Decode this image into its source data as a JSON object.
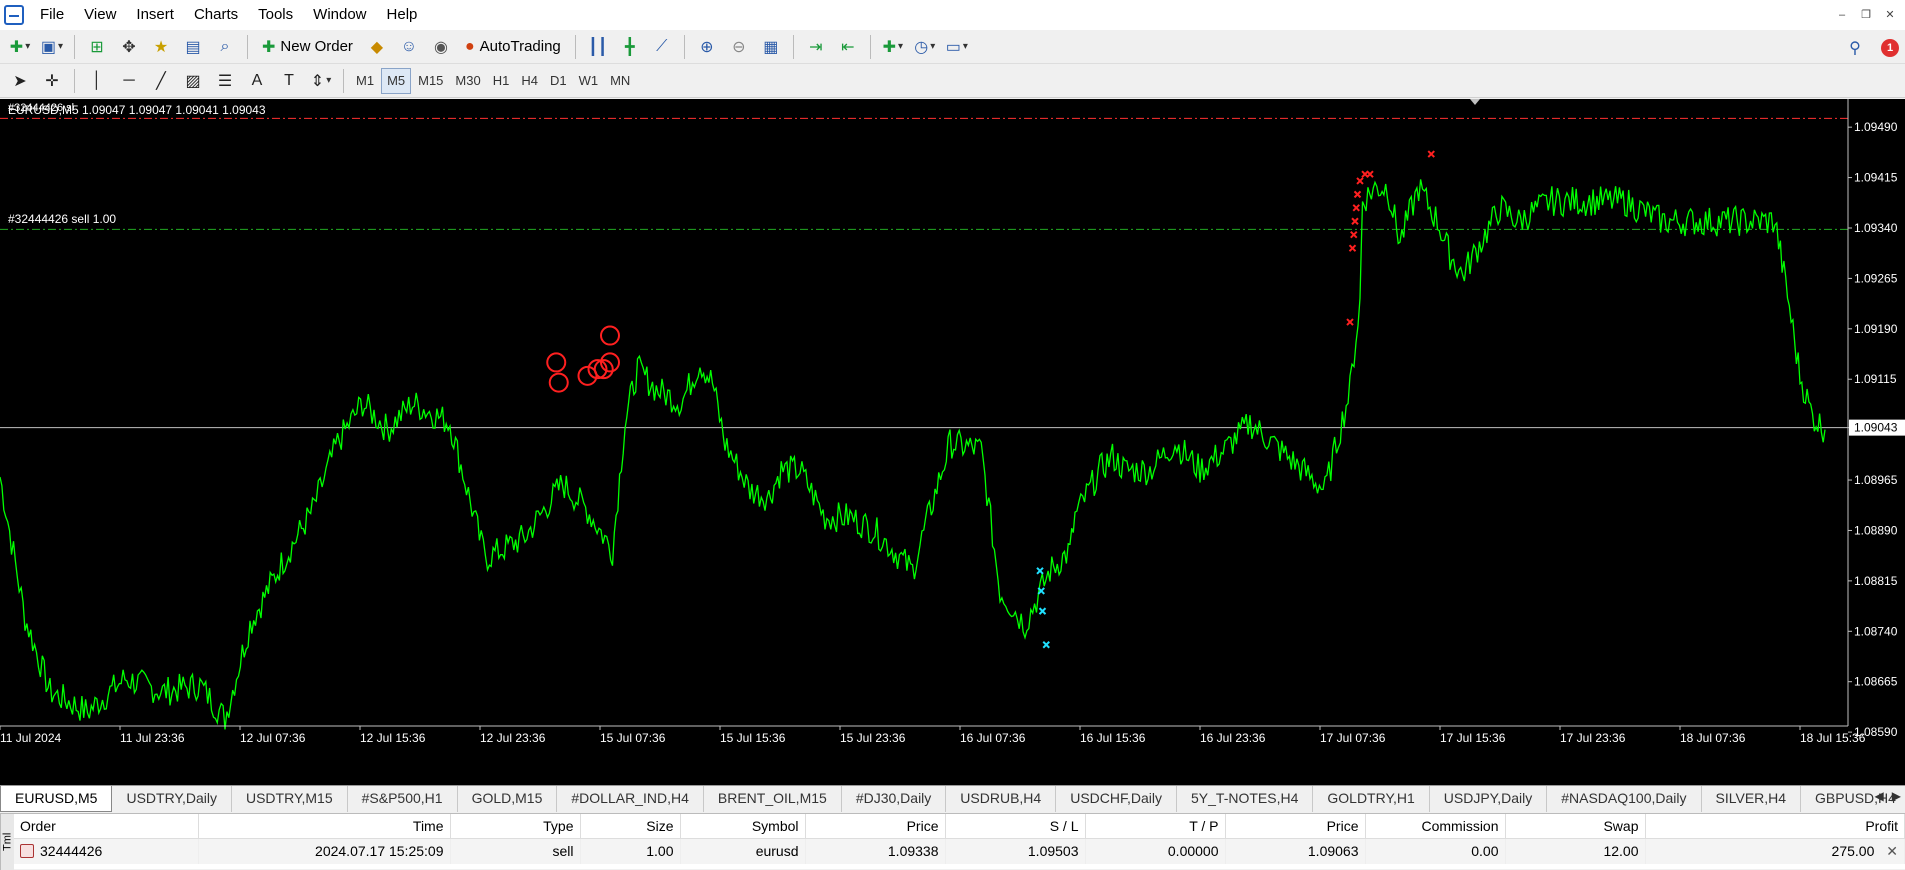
{
  "menu": [
    "File",
    "View",
    "Insert",
    "Charts",
    "Tools",
    "Window",
    "Help"
  ],
  "toolbar": {
    "new_order": "New Order",
    "autotrading": "AutoTrading",
    "alert_count": "1"
  },
  "timeframes": [
    "M1",
    "M5",
    "M15",
    "M30",
    "H1",
    "H4",
    "D1",
    "W1",
    "MN"
  ],
  "active_timeframe": "M5",
  "chart": {
    "symbol_line": "EURUSD,M5  1.09047 1.09047 1.09041 1.09043",
    "order_tag": "#32444426 sl",
    "sell_line_label": "#32444426 sell 1.00",
    "current_price_label": "1.09043",
    "colors": {
      "background": "#000000",
      "line": "#00ff00",
      "sl_line": "#ff3030",
      "order_line": "#22aa22",
      "current_price": "#c0c0c0"
    }
  },
  "chart_data": {
    "type": "line",
    "symbol": "EURUSD",
    "timeframe": "M5",
    "ylim": [
      1.0855,
      1.0952
    ],
    "y_ticks": [
      1.0949,
      1.09415,
      1.0934,
      1.09265,
      1.0919,
      1.09115,
      1.09043,
      1.08965,
      1.0889,
      1.08815,
      1.0874,
      1.08665,
      1.0859
    ],
    "y_tick_labels": [
      "1.09490",
      "1.09415",
      "1.09340",
      "1.09265",
      "1.09190",
      "1.09115",
      "1.09043",
      "1.08965",
      "1.08890",
      "1.08815",
      "1.08740",
      "1.08665",
      "1.08590"
    ],
    "x_tick_labels": [
      "11 Jul 2024",
      "11 Jul 23:36",
      "12 Jul 07:36",
      "12 Jul 15:36",
      "12 Jul 23:36",
      "15 Jul 07:36",
      "15 Jul 15:36",
      "15 Jul 23:36",
      "16 Jul 07:36",
      "16 Jul 15:36",
      "16 Jul 23:36",
      "17 Jul 07:36",
      "17 Jul 15:36",
      "17 Jul 23:36",
      "18 Jul 07:36",
      "18 Jul 15:36"
    ],
    "x_tick_index": [
      0,
      96,
      192,
      288,
      384,
      480,
      576,
      672,
      768,
      864,
      960,
      1056,
      1152,
      1248,
      1344,
      1440
    ],
    "series": [
      {
        "x": [
          0,
          20,
          40,
          70,
          100,
          130,
          160,
          180,
          200,
          225,
          250,
          270,
          290,
          310,
          330,
          360,
          385,
          390,
          420,
          450,
          470,
          490,
          500,
          510,
          525,
          545,
          560,
          570,
          580,
          600,
          615,
          625,
          640,
          660,
          680,
          700,
          730,
          760,
          785,
          800,
          820,
          840,
          856,
          860,
          880,
          890,
          900,
          920,
          940,
          960,
          980,
          1000,
          1030,
          1060,
          1080,
          1088,
          1090,
          1100,
          1110,
          1120,
          1135,
          1150,
          1160,
          1170,
          1185,
          1200,
          1215,
          1240,
          1270,
          1300,
          1330,
          1360,
          1390,
          1420,
          1430,
          1440,
          1450,
          1460
        ],
        "y": [
          1.0897,
          1.0876,
          1.0865,
          1.0862,
          1.0867,
          1.0865,
          1.0866,
          1.0861,
          1.0875,
          1.0884,
          1.0892,
          1.0902,
          1.0908,
          1.0904,
          1.0908,
          1.0905,
          1.0887,
          1.0885,
          1.0888,
          1.0896,
          1.0892,
          1.0886,
          1.0905,
          1.0913,
          1.091,
          1.0908,
          1.0914,
          1.0911,
          1.0902,
          1.0895,
          1.0894,
          1.0898,
          1.0898,
          1.0891,
          1.0891,
          1.0889,
          1.0883,
          1.0902,
          1.0901,
          1.088,
          1.0875,
          1.0883,
          1.0886,
          1.0891,
          1.0898,
          1.09,
          1.0898,
          1.0898,
          1.0902,
          1.0898,
          1.0901,
          1.0905,
          1.09,
          1.0895,
          1.091,
          1.0923,
          1.0938,
          1.094,
          1.094,
          1.0932,
          1.094,
          1.0935,
          1.093,
          1.0927,
          1.0932,
          1.0937,
          1.0935,
          1.0938,
          1.0938,
          1.0938,
          1.0935,
          1.0935,
          1.0935,
          1.0935,
          1.0924,
          1.0912,
          1.0906,
          1.0904
        ]
      }
    ],
    "sl_level": 1.09503,
    "order_level": 1.09338,
    "current_price": 1.09043
  },
  "symbol_tabs": [
    "EURUSD,M5",
    "USDTRY,Daily",
    "USDTRY,M15",
    "#S&P500,H1",
    "GOLD,M15",
    "#DOLLAR_IND,H4",
    "BRENT_OIL,M15",
    "#DJ30,Daily",
    "USDRUB,H4",
    "USDCHF,Daily",
    "5Y_T-NOTES,H4",
    "GOLDTRY,H1",
    "USDJPY,Daily",
    "#NASDAQ100,Daily",
    "SILVER,H4",
    "GBPUSD,H4"
  ],
  "active_tab": 0,
  "trade": {
    "side_label": "Tml",
    "headers": [
      "Order",
      "Time",
      "Type",
      "Size",
      "Symbol",
      "Price",
      "S / L",
      "T / P",
      "Price",
      "Commission",
      "Swap",
      "Profit"
    ],
    "row": [
      "32444426",
      "2024.07.17 15:25:09",
      "sell",
      "1.00",
      "eurusd",
      "1.09338",
      "1.09503",
      "0.00000",
      "1.09063",
      "0.00",
      "12.00",
      "275.00"
    ]
  }
}
